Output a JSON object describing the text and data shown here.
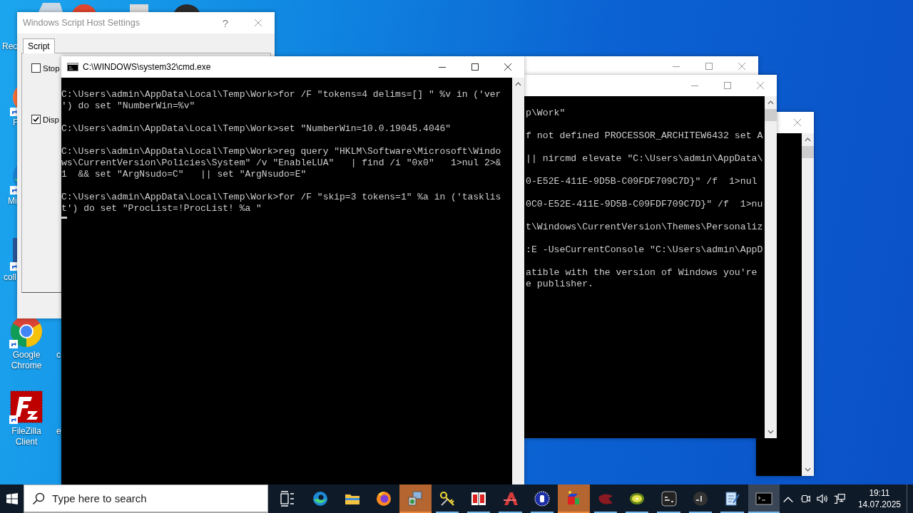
{
  "desktop_icons": [
    {
      "label": "Rec"
    },
    {
      "label": "F",
      "kind": "firefox"
    },
    {
      "label": "Mi",
      "kind": "edge"
    },
    {
      "label": "coll",
      "kind": "word"
    },
    {
      "label": "Google Chrome",
      "kind": "chrome"
    },
    {
      "label": "FileZilla Client",
      "kind": "filezilla"
    },
    {
      "label": "c"
    },
    {
      "label": "e"
    }
  ],
  "wsh_dialog": {
    "title": "Windows Script Host Settings",
    "help": "?",
    "tabs": [
      {
        "label": "Script",
        "selected": true
      }
    ],
    "options": [
      {
        "label": "Stop",
        "checked": false
      },
      {
        "label": "Disp",
        "checked": true
      }
    ]
  },
  "console": {
    "title": "C:\\WINDOWS\\system32\\cmd.exe",
    "cursor": true,
    "blocks": [
      [
        "C:\\Users\\admin\\AppData\\Local\\Temp\\Work>for /F \"tokens=4 delims=[] \" %v in ('ver",
        "') do set \"NumberWin=%v\""
      ],
      [
        "C:\\Users\\admin\\AppData\\Local\\Temp\\Work>set \"NumberWin=10.0.19045.4046\""
      ],
      [
        "C:\\Users\\admin\\AppData\\Local\\Temp\\Work>reg query \"HKLM\\Software\\Microsoft\\Windo",
        "ws\\CurrentVersion\\Policies\\System\" /v \"EnableLUA\"   | find /i \"0x0\"   1>nul 2>&",
        "1  && set \"ArgNsudo=C\"   || set \"ArgNsudo=E\""
      ],
      [
        "C:\\Users\\admin\\AppData\\Local\\Temp\\Work>for /F \"skip=3 tokens=1\" %a in ('tasklis",
        "t') do set \"ProcList=!ProcList! %a \""
      ]
    ]
  },
  "back_console": {
    "blocks": [
      [
        "p\\Work\""
      ],
      [
        "f not defined PROCESSOR_ARCHITEW6432 set A"
      ],
      [
        "|| nircmd elevate \"C:\\Users\\admin\\AppData\\"
      ],
      [
        "0-E52E-411E-9D5B-C09FDF709C7D}\" /f  1>nul"
      ],
      [
        "0C0-E52E-411E-9D5B-C09FDF709C7D}\" /f  1>nu"
      ],
      [
        "t\\Windows\\CurrentVersion\\Themes\\Personaliz"
      ],
      [
        ":E -UseCurrentConsole \"C:\\Users\\admin\\AppD"
      ],
      [
        "atible with the version of Windows you're",
        "e publisher."
      ]
    ]
  },
  "taskbar": {
    "search": {
      "placeholder": "Type here to search"
    },
    "apps": [
      {
        "kind": "task-view",
        "running": false,
        "flashing": false,
        "selected": false
      },
      {
        "kind": "edge",
        "running": false,
        "flashing": false,
        "selected": false
      },
      {
        "kind": "explorer",
        "running": false,
        "flashing": false,
        "selected": false
      },
      {
        "kind": "firefox",
        "running": false,
        "flashing": false,
        "selected": false
      },
      {
        "kind": "installer",
        "running": true,
        "flashing": true,
        "selected": false
      },
      {
        "kind": "keys",
        "running": true,
        "flashing": false,
        "selected": false
      },
      {
        "kind": "split",
        "running": true,
        "flashing": false,
        "selected": false
      },
      {
        "kind": "red-app",
        "running": true,
        "flashing": false,
        "selected": false
      },
      {
        "kind": "r-logo",
        "running": true,
        "flashing": false,
        "selected": false
      },
      {
        "kind": "cube",
        "running": true,
        "flashing": true,
        "selected": false
      },
      {
        "kind": "bird",
        "running": true,
        "flashing": false,
        "selected": false
      },
      {
        "kind": "kiwi",
        "running": true,
        "flashing": false,
        "selected": false
      },
      {
        "kind": "cmd",
        "running": true,
        "flashing": false,
        "selected": false
      },
      {
        "kind": "terminal",
        "running": true,
        "flashing": false,
        "selected": false
      },
      {
        "kind": "notepad",
        "running": true,
        "flashing": false,
        "selected": false
      },
      {
        "kind": "console",
        "running": true,
        "flashing": false,
        "selected": true
      }
    ],
    "tray": {
      "time": "19:11",
      "date": "14.07.2025"
    }
  }
}
